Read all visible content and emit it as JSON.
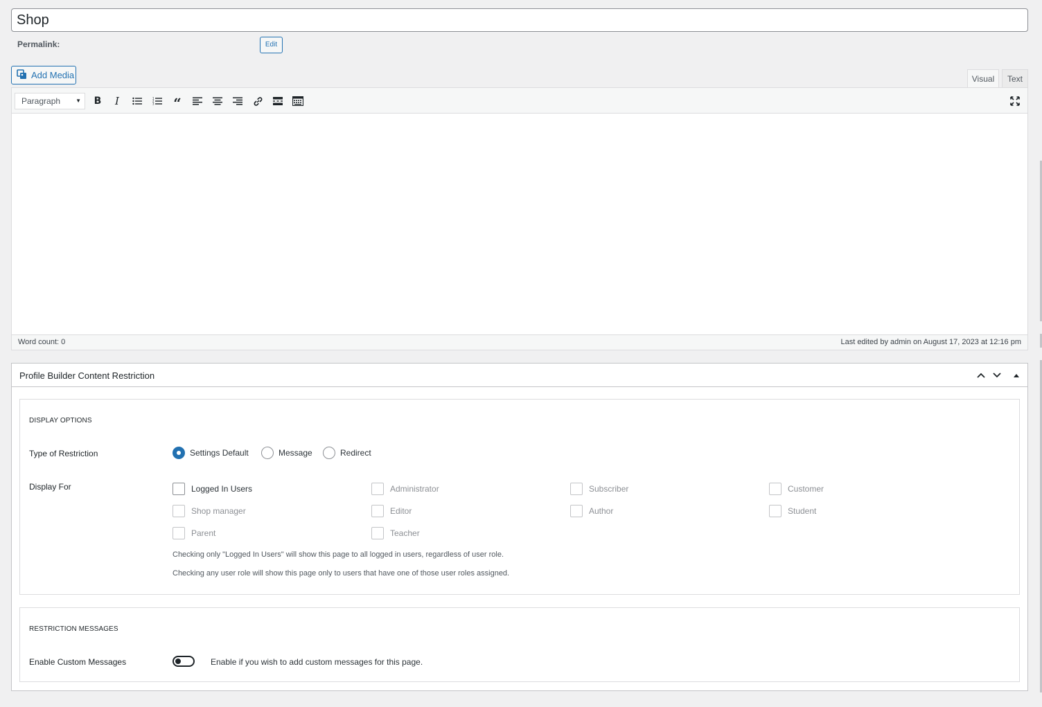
{
  "post": {
    "title": "Shop",
    "permalink_label": "Permalink:",
    "edit_label": "Edit"
  },
  "media": {
    "add_media_label": "Add Media"
  },
  "editor": {
    "tabs": {
      "visual": "Visual",
      "text": "Text"
    },
    "format_select": "Paragraph",
    "toolbar_icons": [
      "bold-icon",
      "italic-icon",
      "bulleted-list-icon",
      "numbered-list-icon",
      "blockquote-icon",
      "align-left-icon",
      "align-center-icon",
      "align-right-icon",
      "link-icon",
      "read-more-icon",
      "toolbar-toggle-icon",
      "fullscreen-icon"
    ],
    "word_count": "Word count: 0",
    "last_edited": "Last edited by admin on August 17, 2023 at 12:16 pm"
  },
  "metabox": {
    "title": "Profile Builder Content Restriction",
    "display_options": {
      "heading": "DISPLAY OPTIONS",
      "type_label": "Type of Restriction",
      "restriction_types": [
        {
          "label": "Settings Default",
          "checked": true
        },
        {
          "label": "Message",
          "checked": false
        },
        {
          "label": "Redirect",
          "checked": false
        }
      ],
      "display_for_label": "Display For",
      "roles": [
        {
          "label": "Logged In Users",
          "enabled": true
        },
        {
          "label": "Administrator",
          "enabled": false
        },
        {
          "label": "Subscriber",
          "enabled": false
        },
        {
          "label": "Customer",
          "enabled": false
        },
        {
          "label": "Shop manager",
          "enabled": false
        },
        {
          "label": "Editor",
          "enabled": false
        },
        {
          "label": "Author",
          "enabled": false
        },
        {
          "label": "Student",
          "enabled": false
        },
        {
          "label": "Parent",
          "enabled": false
        },
        {
          "label": "Teacher",
          "enabled": false
        }
      ],
      "help_1": "Checking only \"Logged In Users\" will show this page to all logged in users, regardless of user role.",
      "help_2": "Checking any user role will show this page only to users that have one of those user roles assigned."
    },
    "restriction_messages": {
      "heading": "RESTRICTION MESSAGES",
      "enable_label": "Enable Custom Messages",
      "enable_checked": false,
      "enable_description": "Enable if you wish to add custom messages for this page."
    }
  }
}
